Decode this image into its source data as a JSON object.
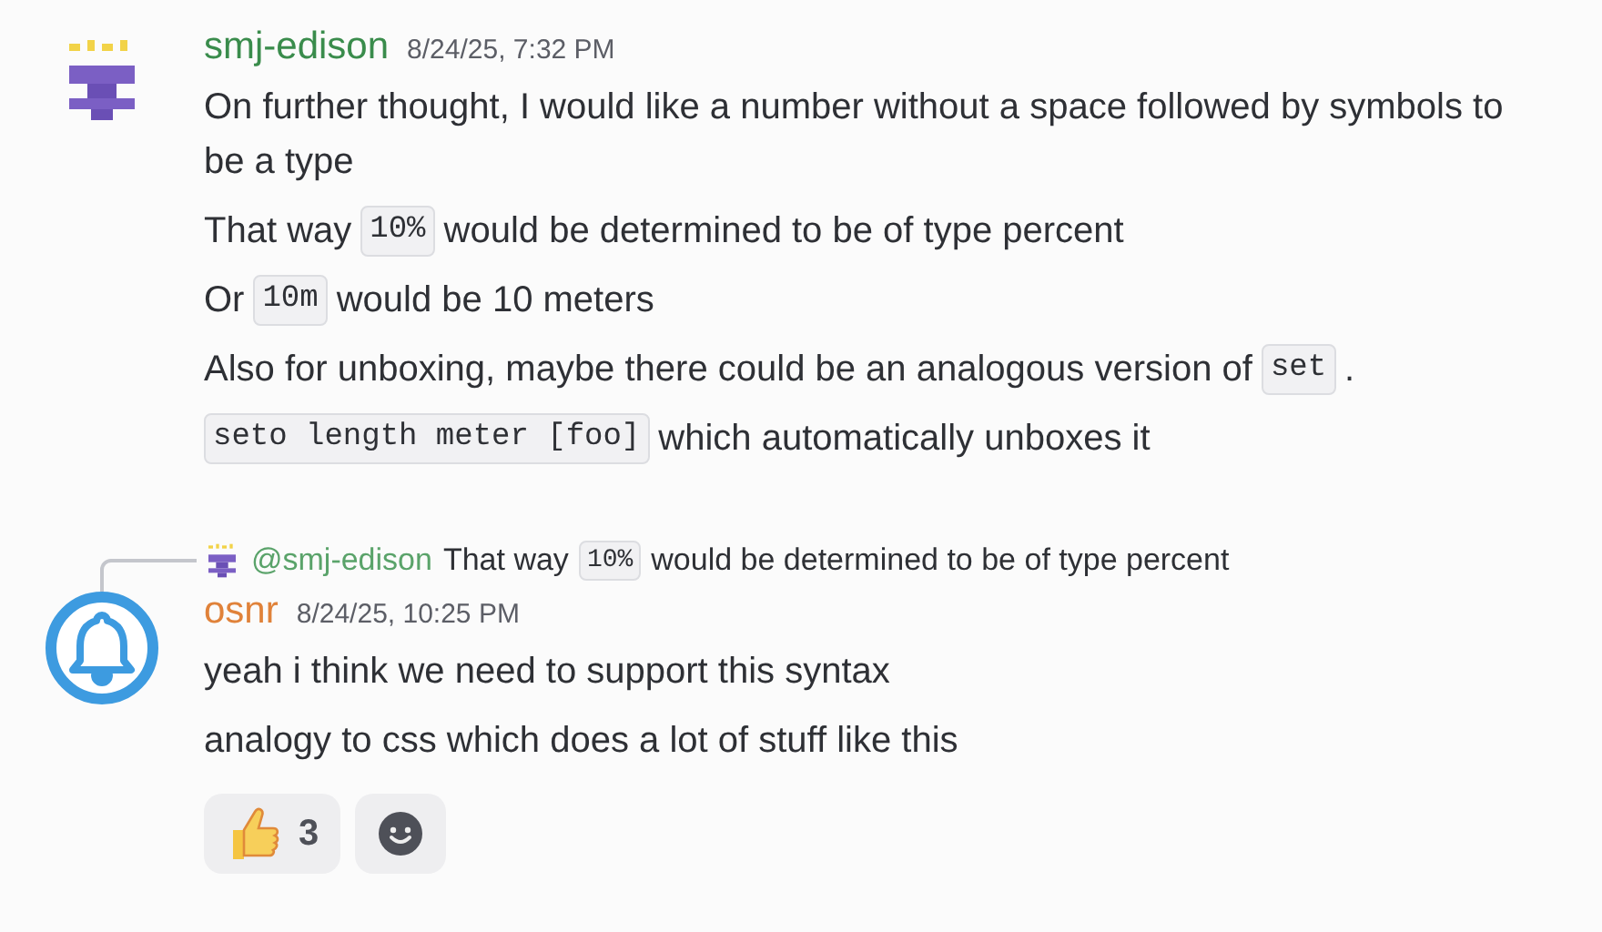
{
  "messages": [
    {
      "author": "smj-edison",
      "color": "#3a8c4c",
      "avatar": {
        "kind": "pixel"
      },
      "time": "8/24/25, 7:32 PM",
      "lines": [
        [
          {
            "kind": "text",
            "text": "On further thought, I would like a number without a space followed by symbols to be a type"
          }
        ],
        [
          {
            "kind": "text",
            "text": "That way"
          },
          {
            "kind": "code",
            "text": "10%"
          },
          {
            "kind": "text",
            "text": "would be determined to be of type percent"
          }
        ],
        [
          {
            "kind": "text",
            "text": "Or"
          },
          {
            "kind": "code",
            "text": "10m"
          },
          {
            "kind": "text",
            "text": "would be 10 meters"
          }
        ],
        [
          {
            "kind": "text",
            "text": "Also for unboxing, maybe there could be an analogous version of"
          },
          {
            "kind": "code",
            "text": "set"
          },
          {
            "kind": "text",
            "text": "."
          }
        ],
        [
          {
            "kind": "code",
            "text": "seto length meter [foo]"
          },
          {
            "kind": "text",
            "text": "which automatically unboxes it"
          }
        ]
      ]
    },
    {
      "author": "osnr",
      "color": "#e0823a",
      "avatar": {
        "kind": "bell"
      },
      "time": "8/24/25, 10:25 PM",
      "reply": {
        "mention": "@smj-edison",
        "color": "#5aa36a",
        "parts": [
          {
            "kind": "text",
            "text": "That way"
          },
          {
            "kind": "code",
            "text": "10%"
          },
          {
            "kind": "text",
            "text": "would be determined to be of type percent"
          }
        ]
      },
      "lines": [
        [
          {
            "kind": "text",
            "text": "yeah i think we need to support this syntax"
          }
        ],
        [
          {
            "kind": "text",
            "text": "analogy to css which does a lot of stuff like this"
          }
        ]
      ],
      "reactions": [
        {
          "kind": "thumbs",
          "count": "3"
        },
        {
          "kind": "add"
        }
      ]
    }
  ]
}
